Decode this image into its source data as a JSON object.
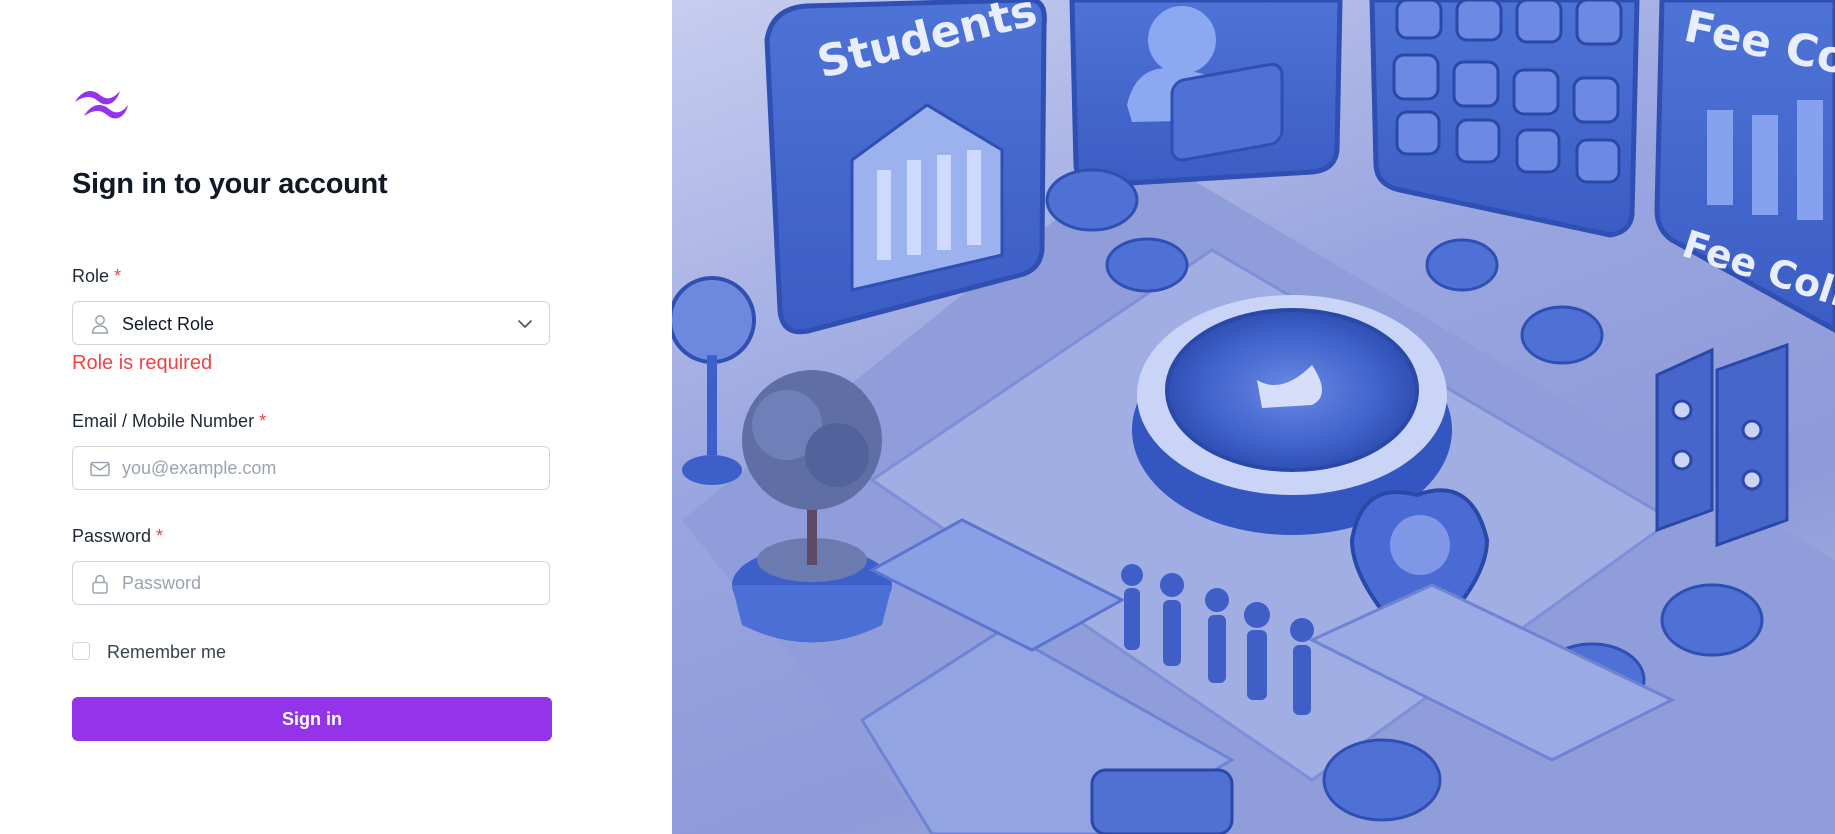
{
  "page": {
    "title": "Sign in to your account"
  },
  "form": {
    "role": {
      "label": "Role",
      "required_mark": "*",
      "value": "Select Role",
      "error": "Role is required"
    },
    "email": {
      "label": "Email / Mobile Number",
      "required_mark": "*",
      "value": "",
      "placeholder": "you@example.com"
    },
    "password": {
      "label": "Password",
      "required_mark": "*",
      "value": "",
      "placeholder": "Password"
    },
    "remember": {
      "label": "Remember me",
      "checked": false
    },
    "submit_label": "Sign in"
  },
  "illustration": {
    "sign_left": "Students",
    "sign_right": "Fee Coll",
    "sign_right_lower": "Fee Colle"
  },
  "colors": {
    "brand": "#9333ea",
    "error": "#ef4444",
    "illustration_blue": "#4a6fd6"
  },
  "icons": {
    "logo": "tailwind-wave-logo",
    "role": "user-icon",
    "email": "envelope-icon",
    "password": "lock-icon",
    "dropdown": "chevron-down-icon"
  }
}
